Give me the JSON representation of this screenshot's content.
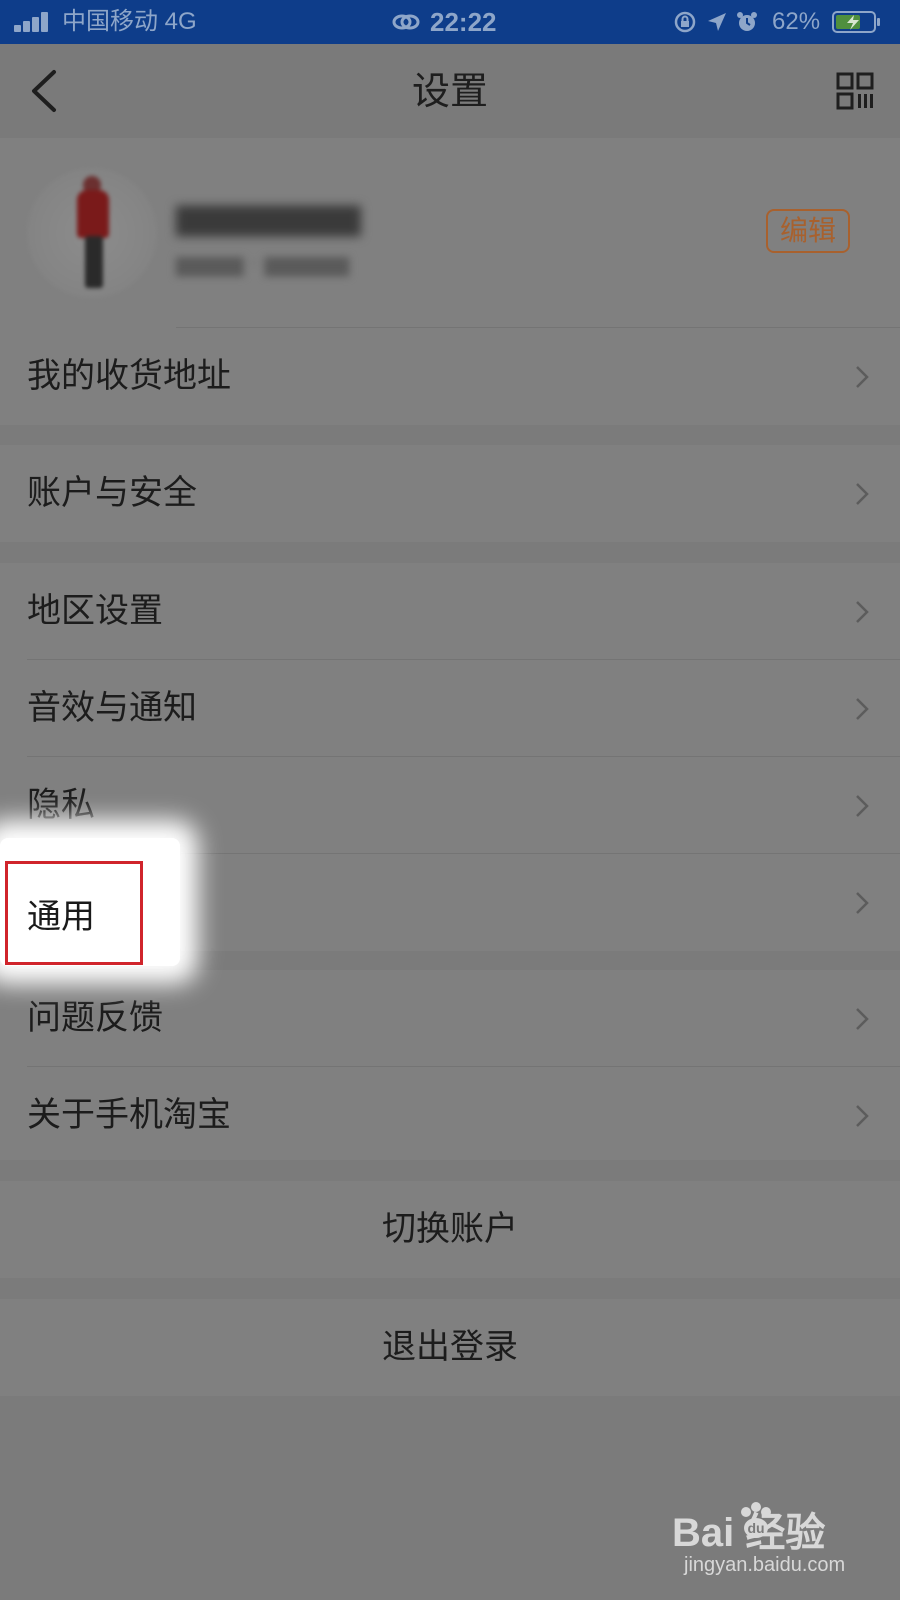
{
  "status_bar": {
    "carrier": "中国移动  4G",
    "time": "22:22",
    "battery_percent": "62%",
    "icons": [
      "signal-icon",
      "link-icon",
      "rotation-lock-icon",
      "location-icon",
      "alarm-icon",
      "battery-icon"
    ]
  },
  "nav": {
    "title": "设置",
    "back_icon": "back-arrow-icon",
    "qr_icon": "qr-code-icon"
  },
  "profile": {
    "edit_label": "编辑"
  },
  "sections": {
    "address": {
      "label": "我的收货地址"
    },
    "account_security": {
      "label": "账户与安全"
    },
    "group3": [
      "地区设置",
      "音效与通知",
      "隐私",
      "通用"
    ],
    "group4": [
      "问题反馈",
      "关于手机淘宝"
    ],
    "switch_account": "切换账户",
    "logout": "退出登录"
  },
  "highlighted_item": "通用",
  "watermark": {
    "logo": "Bai   经验",
    "url": "jingyan.baidu.com"
  },
  "colors": {
    "status_bar_bg": "#0e3d8a",
    "page_bg": "#7b7b7b",
    "highlight_border": "#d0242b",
    "edit_accent": "#a8612e"
  }
}
